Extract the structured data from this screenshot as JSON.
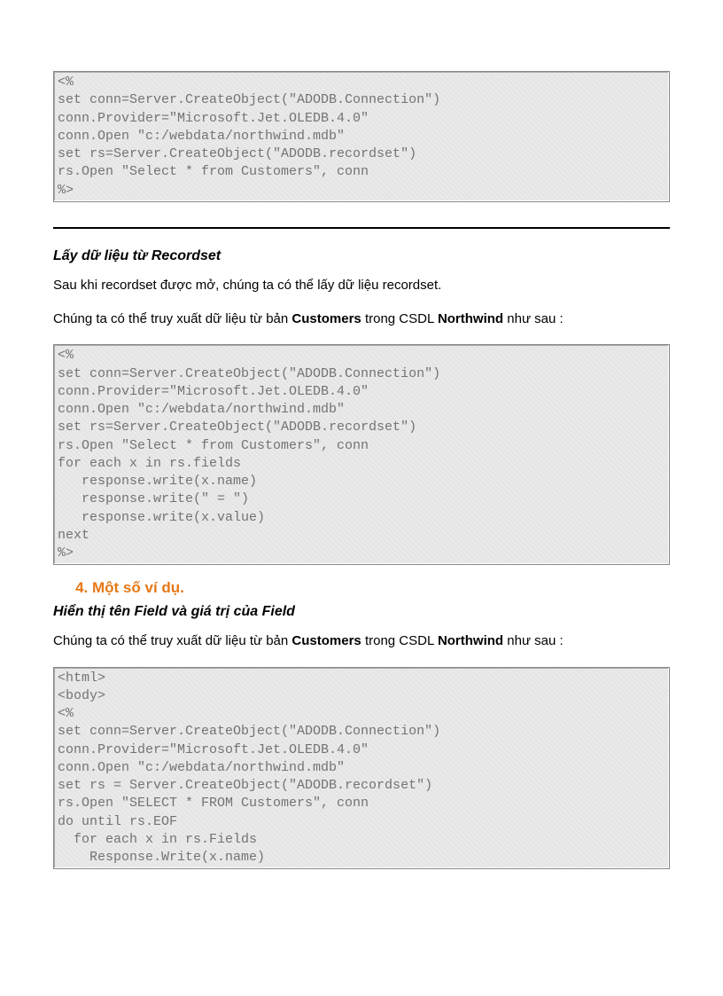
{
  "code1": "<%\nset conn=Server.CreateObject(\"ADODB.Connection\")\nconn.Provider=\"Microsoft.Jet.OLEDB.4.0\"\nconn.Open \"c:/webdata/northwind.mdb\"\nset rs=Server.CreateObject(\"ADODB.recordset\")\nrs.Open \"Select * from Customers\", conn\n%>",
  "heading1": "Lấy dữ liệu từ Recordset",
  "para1": "Sau khi recordset được mở, chúng ta có thể lấy dữ liệu recordset.",
  "para2_pre": "Chúng ta có thể truy xuất dữ liệu từ bản ",
  "para2_b1": "Customers",
  "para2_mid": " trong CSDL ",
  "para2_b2": "Northwind",
  "para2_post": " như sau :",
  "code2": "<%\nset conn=Server.CreateObject(\"ADODB.Connection\")\nconn.Provider=\"Microsoft.Jet.OLEDB.4.0\"\nconn.Open \"c:/webdata/northwind.mdb\"\nset rs=Server.CreateObject(\"ADODB.recordset\")\nrs.Open \"Select * from Customers\", conn\nfor each x in rs.fields\n   response.write(x.name)\n   response.write(\" = \")\n   response.write(x.value)\nnext\n%>",
  "list_item4": "Một số ví dụ.",
  "heading2": "Hiển thị tên Field và giá trị của Field",
  "para3_pre": "Chúng ta có thể truy xuất dữ liệu từ bản ",
  "para3_b1": "Customers",
  "para3_mid": " trong CSDL ",
  "para3_b2": "Northwind",
  "para3_post": " như sau :",
  "code3": "<html>\n<body>\n<%\nset conn=Server.CreateObject(\"ADODB.Connection\")\nconn.Provider=\"Microsoft.Jet.OLEDB.4.0\"\nconn.Open \"c:/webdata/northwind.mdb\"\nset rs = Server.CreateObject(\"ADODB.recordset\")\nrs.Open \"SELECT * FROM Customers\", conn\ndo until rs.EOF\n  for each x in rs.Fields\n    Response.Write(x.name)"
}
